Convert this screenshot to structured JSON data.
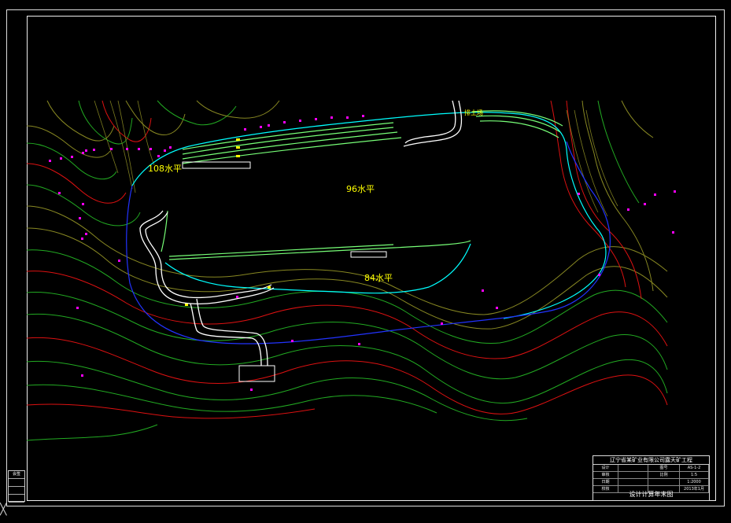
{
  "drawing": {
    "labels": {
      "level_108": "108水平",
      "level_96": "96水平",
      "level_84": "84水平",
      "road": "排土场"
    },
    "colors": {
      "background": "#000000",
      "frame": "#dddddd",
      "contour_green": "#22aa22",
      "contour_red": "#dd1111",
      "contour_olive": "#888822",
      "pit_boundary_blue": "#2233ff",
      "bench_cyan": "#00ffff",
      "bench_light_green": "#77ff77",
      "road_white": "#ffffff",
      "marker_magenta": "#ff00ff",
      "label_yellow": "#ffff00"
    }
  },
  "title_block": {
    "header": "辽宁省某矿业有限公司露天矿工程",
    "rows": [
      [
        "设计",
        "",
        "图号",
        "AS-1-2"
      ],
      [
        "审核",
        "",
        "比例",
        "1:5"
      ],
      [
        "日期",
        "",
        "",
        "1:2000"
      ],
      [
        "校核",
        "",
        "",
        "2013年1月"
      ]
    ],
    "drawing_title": "设计计算年末图"
  },
  "side_box": {
    "cells": [
      "会签",
      "",
      "",
      ""
    ]
  }
}
